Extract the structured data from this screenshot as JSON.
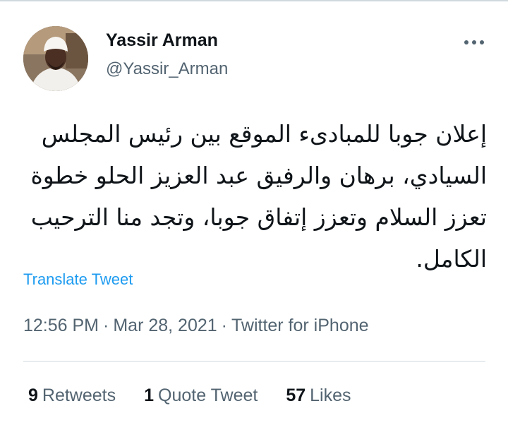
{
  "author": {
    "display_name": "Yassir Arman",
    "handle": "@Yassir_Arman"
  },
  "tweet": {
    "text": "إعلان جوبا للمبادىء الموقع بين رئيس المجلس السيادي، برهان والرفيق عبد العزيز الحلو خطوة تعزز السلام وتعزز إتفاق جوبا، وتجد منا الترحيب الكامل.",
    "translate_label": "Translate Tweet"
  },
  "meta": {
    "time": "12:56 PM",
    "separator": "·",
    "date": "Mar 28, 2021",
    "source": "Twitter for iPhone"
  },
  "stats": {
    "retweets_count": "9",
    "retweets_label": "Retweets",
    "quotes_count": "1",
    "quotes_label": "Quote Tweet",
    "likes_count": "57",
    "likes_label": "Likes"
  },
  "colors": {
    "link": "#1d9bf0",
    "secondary_text": "#536471",
    "primary_text": "#0f1419",
    "divider": "#cfd9de"
  },
  "icons": {
    "more": "more-horizontal-icon"
  }
}
